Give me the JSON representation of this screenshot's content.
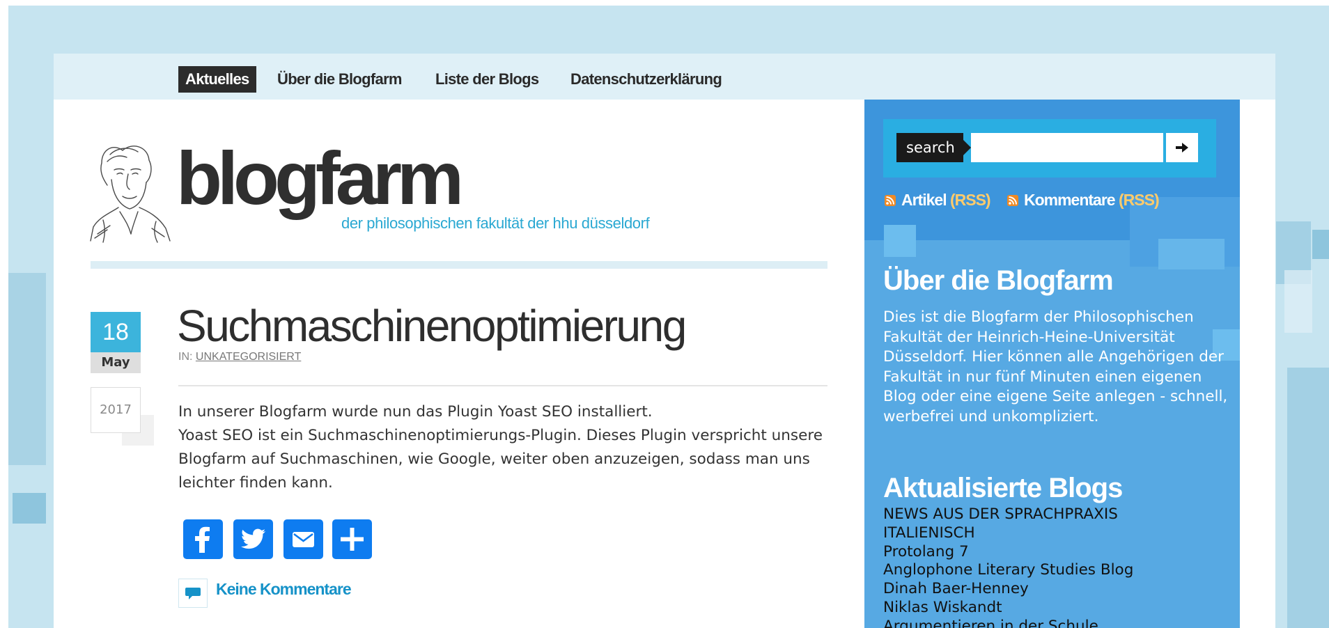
{
  "nav": {
    "items": [
      {
        "label": "Aktuelles",
        "active": true
      },
      {
        "label": "Über die Blogfarm",
        "active": false
      },
      {
        "label": "Liste der Blogs",
        "active": false
      },
      {
        "label": "Datenschutzerklärung",
        "active": false
      }
    ]
  },
  "logo": {
    "wordmark": "blogfarm",
    "tagline": "der philosophischen fakultät der hhu düsseldorf"
  },
  "post": {
    "date": {
      "day": "18",
      "month": "May",
      "year": "2017"
    },
    "title": "Suchmaschinenoptimierung",
    "category_prefix": "IN:",
    "category": "UNKATEGORISIERT",
    "paragraphs": [
      "In unserer Blogfarm wurde nun das Plugin Yoast SEO installiert.",
      "Yoast SEO ist ein Suchmaschinenoptimierungs-Plugin. Dieses Plugin verspricht unsere Blogfarm auf Suchmaschinen, wie Google, weiter oben anzuzeigen, sodass man uns leichter finden kann."
    ],
    "share_buttons": [
      "facebook-icon",
      "twitter-icon",
      "email-icon",
      "share-plus-icon"
    ],
    "comments_label": "Keine Kommentare"
  },
  "sidebar": {
    "search": {
      "label": "search",
      "value": "",
      "button_icon": "arrow-right-icon"
    },
    "feeds": [
      {
        "label": "Artikel",
        "suffix": "(RSS)"
      },
      {
        "label": "Kommentare",
        "suffix": "(RSS)"
      }
    ],
    "about": {
      "title": "Über die Blogfarm",
      "text": "Dies ist die Blogfarm der Philosophischen Fakultät der Heinrich-Heine-Universität Düsseldorf. Hier können alle Angehörigen der Fakultät in nur fünf Minuten einen eigenen Blog oder eine eigene Seite anlegen - schnell, werbefrei und unkompliziert."
    },
    "updated_blogs": {
      "title": "Aktualisierte Blogs",
      "items": [
        "NEWS AUS DER SPRACHPRAXIS ITALIENISCH",
        "Protolang 7",
        "Anglophone Literary Studies Blog",
        "Dinah Baer-Henney",
        "Niklas Wiskandt",
        "Argumentieren in der Schule"
      ]
    }
  },
  "colors": {
    "page_bg": "#c6e4f0",
    "nav_bg": "#dff0f7",
    "accent": "#3cb4dc",
    "sidebar": "#57a9e3",
    "sidebar_top": "#3d95dc",
    "share_blue": "#0e7cf0",
    "rss_orange": "#f08a24",
    "link": "#1692c8"
  }
}
